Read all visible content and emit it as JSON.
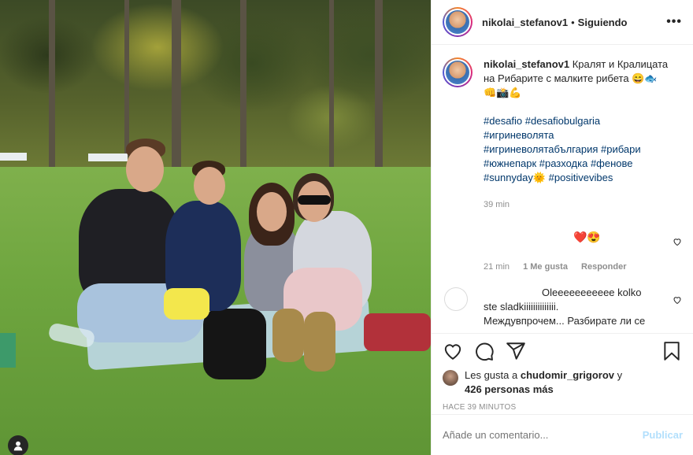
{
  "post": {
    "username": "nikolai_stefanov1",
    "separator": "•",
    "follow_status": "Siguiendo",
    "more_label": "•••"
  },
  "caption": {
    "username": "nikolai_stefanov1",
    "text": "Кралят и Кралицата на Рибарите с малките рибета 😄🐟",
    "emoji_line": "👊📸💪",
    "hashtags_line1": "#desafio #desafiobulgaria",
    "hashtags_line2": "#игриневолята",
    "hashtags_line3": "#игриневолятабългария #рибари",
    "hashtags_line4": "#южнепарк #разходка #фенове",
    "hashtags_line5": "#sunnyday🌞 #positivevibes",
    "time": "39 min"
  },
  "comment1": {
    "text": "❤️😍",
    "time": "21 min",
    "likes": "1 Me gusta",
    "reply": "Responder"
  },
  "comment2": {
    "line1": "Oleeeeeeeeeee kolko",
    "line2": "ste sladkiiiiiiiiiiiiii.",
    "line3": "Междувпрочем... Разбирате ли се"
  },
  "likes": {
    "prefix": "Les gusta a",
    "user": "chudomir_grigorov",
    "suffix": "y",
    "others": "426 personas más"
  },
  "posted_ago": "HACE 39 MINUTOS",
  "add_comment": {
    "placeholder": "Añade un comentario...",
    "publish": "Publicar"
  },
  "icons": {
    "like": "heart-icon",
    "comment": "comment-icon",
    "share": "share-icon",
    "save": "bookmark-icon",
    "tag": "user-tag-icon"
  }
}
